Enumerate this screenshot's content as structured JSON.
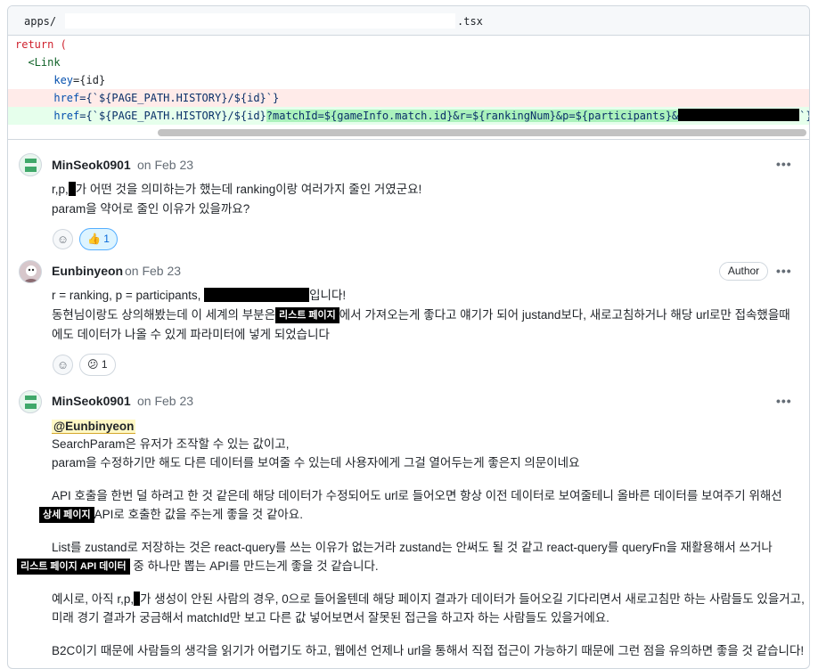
{
  "file": {
    "path_prefix": "apps/",
    "path_suffix": ".tsx"
  },
  "code": {
    "line1": "return (",
    "line2": "  <Link",
    "line3_attr": "key",
    "line3_rest": "={id}",
    "line4_attr": "href",
    "line4_rest": "={`${PAGE_PATH.HISTORY}/${id}`}",
    "line5_attr": "href",
    "line5_pre": "={`${PAGE_PATH.HISTORY}/${id}",
    "line5_added": "?matchId=${gameInfo.match.id}&r=${rankingNum}&p=${participants}&",
    "line5_end": "`}"
  },
  "comments": [
    {
      "author": "MinSeok0901",
      "date": "on Feb 23",
      "line1_a": "r,p,",
      "line1_b": "가 어떤 것을 의미하는가 했는데 ranking이랑 여러가지 줄인 거였군요!",
      "line2": "param을 약어로 줄인 이유가 있을까요?",
      "reaction": "1"
    },
    {
      "author": "Eunbinyeon",
      "date": "on Feb 23",
      "badge": "Author",
      "line1_a": "r = ranking, p = participants,",
      "line1_b": "입니다!",
      "line2_a": "동현님이랑도 상의해봤는데 이 세계의 부분은",
      "chip": "리스트 페이지",
      "line2_b": "에서 가져오는게 좋다고 얘기가 되어 justand보다, 새로고침하거나 해당 url로만 접속했을때",
      "line3": "에도 데이터가 나올 수 있게 파라미터에 넣게 되었습니다",
      "reaction": "1"
    },
    {
      "author": "MinSeok0901",
      "date": "on Feb 23",
      "mention": "@Eunbinyeon",
      "p1_l1": "SearchParam은 유저가 조작할 수 있는 값이고,",
      "p1_l2": "param을 수정하기만 해도 다른 데이터를 보여줄 수 있는데 사용자에게 그걸 열어두는게 좋은지 의문이네요",
      "p2_l1": "API 호출을 한번 덜 하려고 한 것 같은데 해당 데이터가 수정되어도 url로 들어오면 항상 이전 데이터로 보여줄테니 올바른 데이터를 보여주기 위해선",
      "p2_chip": "상세 페이지",
      "p2_l2": "API로 호출한 값을 주는게 좋을 것 같아요.",
      "p3_l1": "List를 zustand로 저장하는 것은 react-query를 쓰는 이유가 없는거라 zustand는 안써도 될 것 같고 react-query를 queryFn을 재활용해서 쓰거나",
      "p3_chip": "리스트 페이지 API 데이터",
      "p3_l2": "중 하나만 뽑는 API를 만드는게 좋을 것 같습니다.",
      "p4_l1_a": "예시로, 아직 r,p,",
      "p4_l1_b": "가 생성이 안된 사람의 경우, 0으로 들어올텐데 해당 페이지 결과가 데이터가 들어오길 기다리면서 새로고침만 하는 사람들도 있을거고,",
      "p4_l2": "미래 경기 결과가 궁금해서 matchId만 보고 다른 값 넣어보면서 잘못된 접근을 하고자 하는 사람들도 있을거에요.",
      "p5_l1": "B2C이기 때문에 사람들의 생각을 읽기가 어렵기도 하고, 웹에선 언제나 url을 통해서 직접 접근이 가능하기 때문에 그런 점을 유의하면 좋을 것 같습니다!"
    }
  ]
}
